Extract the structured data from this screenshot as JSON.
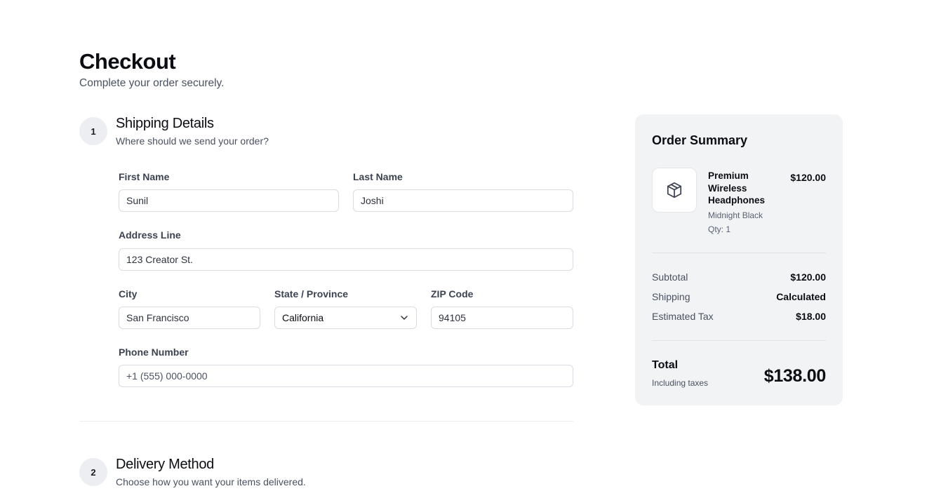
{
  "header": {
    "title": "Checkout",
    "subtitle": "Complete your order securely."
  },
  "shipping": {
    "step_number": "1",
    "title": "Shipping Details",
    "subtitle": "Where should we send your order?",
    "first_name": {
      "label": "First Name",
      "value": "Sunil"
    },
    "last_name": {
      "label": "Last Name",
      "value": "Joshi"
    },
    "address": {
      "label": "Address Line",
      "value": "123 Creator St."
    },
    "city": {
      "label": "City",
      "value": "San Francisco"
    },
    "state": {
      "label": "State / Province",
      "value": "California"
    },
    "zip": {
      "label": "ZIP Code",
      "value": "94105"
    },
    "phone": {
      "label": "Phone Number",
      "placeholder": "+1 (555) 000-0000"
    }
  },
  "delivery": {
    "step_number": "2",
    "title": "Delivery Method",
    "subtitle": "Choose how you want your items delivered."
  },
  "summary": {
    "title": "Order Summary",
    "product": {
      "icon": "package-icon",
      "name": "Premium Wireless Headphones",
      "price": "$120.00",
      "variant": "Midnight Black",
      "qty": "Qty: 1"
    },
    "rows": [
      {
        "label": "Subtotal",
        "value": "$120.00"
      },
      {
        "label": "Shipping",
        "value": "Calculated"
      },
      {
        "label": "Estimated Tax",
        "value": "$18.00"
      }
    ],
    "total_label": "Total",
    "total_note": "Including taxes",
    "total_value": "$138.00"
  }
}
